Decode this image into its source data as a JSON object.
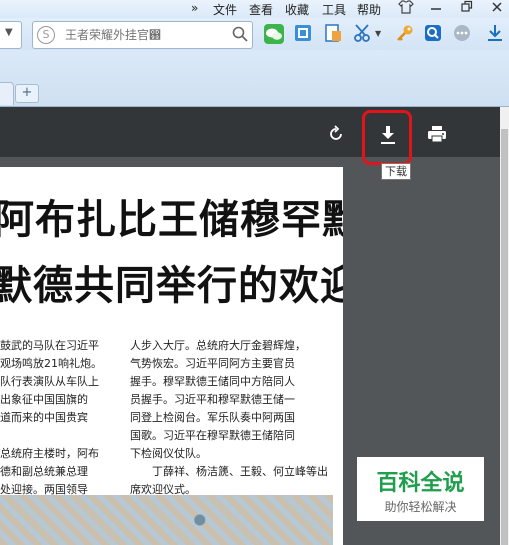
{
  "menu": {
    "overflow": "»",
    "items": [
      "文件",
      "查看",
      "收藏",
      "工具",
      "帮助"
    ]
  },
  "search": {
    "placeholder": "王者荣耀外挂官඘"
  },
  "tabs": {
    "new_tab_label": "+"
  },
  "pdf_toolbar": {
    "download_tooltip": "下载"
  },
  "document": {
    "headline_line1": "阿布扎比王储穆罕默德",
    "headline_line2": "默德共同举行的欢迎仪式",
    "left_column": [
      "鼓武的马队在习近平",
      "观场鸣放21响礼炮。",
      "队行表演队从车队上",
      "出象征中国国旗的",
      "道而来的中国贵宾",
      "",
      "总统府主楼时，阿布",
      "德和副总统兼总理",
      "处迎接。两国领导"
    ],
    "right_column": [
      "人步入大厅。总统府大厅金碧辉煌，",
      "气势恢宏。习近平同阿方主要官员",
      "握手。穆罕默德王储同中方陪同人",
      "员握手。习近平和穆罕默德王储一",
      "同登上检阅台。军乐队奏中阿两国",
      "国歌。习近平在穆罕默德王储陪同",
      "下检阅仪仗队。",
      "　　丁薛祥、杨洁篪、王毅、何立峰等出",
      "席欢迎仪式。"
    ]
  },
  "watermark": {
    "title": "百科全说",
    "subtitle": "助你轻松解决"
  },
  "colors": {
    "highlight": "#e0141b",
    "pdf_toolbar_bg": "#323639",
    "viewer_bg": "#525659",
    "watermark_green": "#1f9e4c"
  }
}
